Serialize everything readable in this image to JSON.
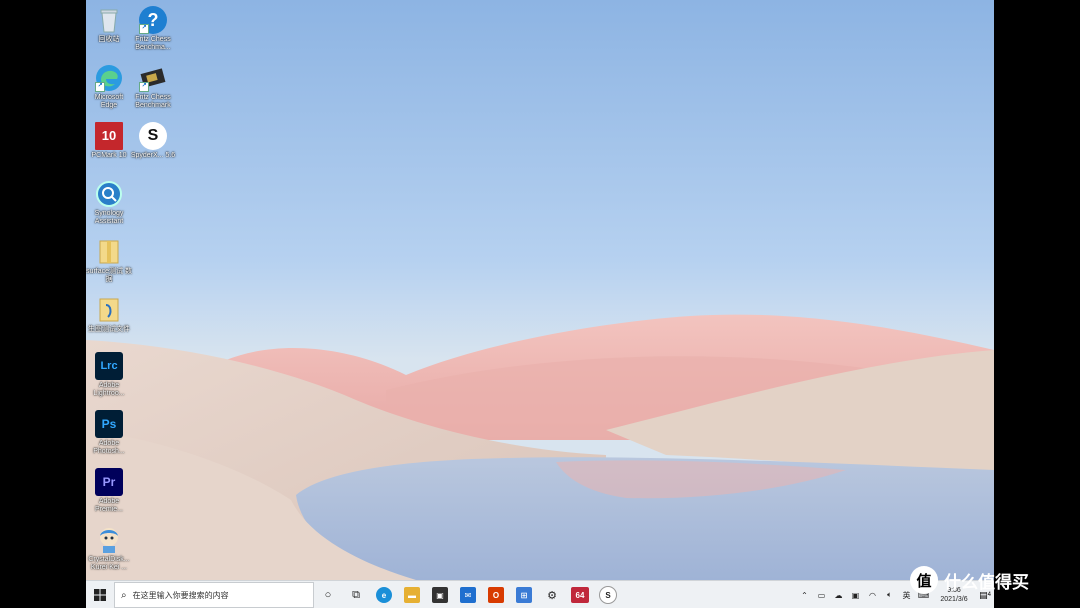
{
  "desktop": {
    "icons": [
      {
        "label": "回收站",
        "icon": "recycle-bin-icon"
      },
      {
        "label": "Fritz Chess Benchma...",
        "icon": "help-icon"
      },
      {
        "label": "Microsoft Edge",
        "icon": "edge-icon"
      },
      {
        "label": "Fritz Chess Benchmark",
        "icon": "chip-icon"
      },
      {
        "label": "PCMark 10",
        "icon": "pcmark-icon",
        "glyph": "10"
      },
      {
        "label": "SpyderX... 5.6",
        "icon": "spyder-icon",
        "glyph": "S"
      },
      {
        "label": "Synology Assistant",
        "icon": "synology-icon"
      },
      {
        "label": "surface测试 数据",
        "icon": "folder-icon"
      },
      {
        "label": "生图测试文件",
        "icon": "folder-icon"
      },
      {
        "label": "Adobe Lightroo...",
        "icon": "lightroom-icon",
        "glyph": "Lrc"
      },
      {
        "label": "Adobe Photosh...",
        "icon": "photoshop-icon",
        "glyph": "Ps"
      },
      {
        "label": "Adobe Premie...",
        "icon": "premiere-icon",
        "glyph": "Pr"
      },
      {
        "label": "CrystalDisk... Kurei Kei ...",
        "icon": "crystaldisk-icon"
      }
    ]
  },
  "taskbar": {
    "search_placeholder": "在这里输入你要搜索的内容",
    "apps": [
      {
        "name": "cortana-icon",
        "glyph": "○"
      },
      {
        "name": "task-view-icon",
        "glyph": "⧉"
      },
      {
        "name": "edge-icon",
        "glyph": "e",
        "color": "#1a8fd8"
      },
      {
        "name": "file-explorer-icon",
        "glyph": "▬",
        "color": "#e6b033"
      },
      {
        "name": "store-icon",
        "glyph": "▣",
        "color": "#333"
      },
      {
        "name": "mail-icon",
        "glyph": "✉",
        "color": "#1f6fcf"
      },
      {
        "name": "office-icon",
        "glyph": "O",
        "color": "#d83b01"
      },
      {
        "name": "network-app-icon",
        "glyph": "⊞",
        "color": "#3a7bd5"
      },
      {
        "name": "settings-icon",
        "glyph": "⚙",
        "color": "#333"
      },
      {
        "name": "aida64-icon",
        "glyph": "64",
        "color": "#c0283b"
      },
      {
        "name": "spyder-icon",
        "glyph": "S",
        "color": "#222"
      }
    ],
    "tray": {
      "input_lang": "英",
      "clock_time": "9:36",
      "clock_date": "2021/3/6",
      "notification_count": "4"
    }
  },
  "watermark": {
    "text": "什么值得买",
    "badge": "值"
  },
  "colors": {
    "taskbar_bg": "#eef1f4",
    "sky_top": "#8fb7e4",
    "sand": "#e8d9cf",
    "hills": "#f0b9b5"
  }
}
